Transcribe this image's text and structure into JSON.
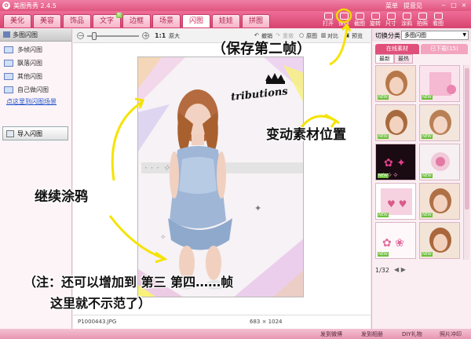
{
  "app": {
    "title": "美图秀秀 2.4.5",
    "menu": [
      "菜单",
      "提意见"
    ]
  },
  "tabs": [
    {
      "label": "美化",
      "active": false
    },
    {
      "label": "美容",
      "active": false
    },
    {
      "label": "饰品",
      "active": false
    },
    {
      "label": "文字",
      "active": false,
      "badge": "新"
    },
    {
      "label": "边框",
      "active": false
    },
    {
      "label": "场景",
      "active": false
    },
    {
      "label": "闪图",
      "active": true
    },
    {
      "label": "娃娃",
      "active": false
    },
    {
      "label": "拼图",
      "active": false
    }
  ],
  "toolbar": [
    "打开",
    "保存",
    "截图",
    "旋转",
    "尺寸",
    "涂鸦",
    "拍照",
    "看图"
  ],
  "left_panel": {
    "header": "多图闪图",
    "items": [
      "多帧闪图",
      "飘落闪图",
      "其他闪图",
      "自己做闪图"
    ],
    "link": "点这里到闪图场景",
    "import_button": "导入闪图"
  },
  "canvas_toolbar": {
    "zoom_out": "－",
    "zoom_in": "＋",
    "zoom_level": "1:1",
    "original_size": "原大",
    "undo": "撤销",
    "redo": "重做",
    "original": "原图",
    "compare": "对比",
    "preview": "预览"
  },
  "status": {
    "filename": "P1000443.JPG",
    "dimensions": "683 × 1024"
  },
  "right_panel": {
    "category_label": "切换分类",
    "category_value": "多图闪图",
    "tabs": [
      "在线素材",
      "已下载(15)"
    ],
    "subtabs": [
      "最新",
      "最热"
    ],
    "thumbnail_badge": "NEW",
    "page": "1/32"
  },
  "bottom_bar": [
    "发到微博",
    "发到相册",
    "DIY礼物",
    "照片冲印"
  ],
  "annotations": {
    "save": "（保存第二帧）",
    "move": "变动素材位置",
    "paint": "继续涂鸦",
    "note_line1": "（注：还可以增加到 第三 第四……帧",
    "note_line2": "这里就不示范了）"
  },
  "photo_text": "tributions",
  "colors": {
    "accent": "#e0557e",
    "annotation_arrow": "#f5e300",
    "highlight_ring": "#f0d800"
  }
}
